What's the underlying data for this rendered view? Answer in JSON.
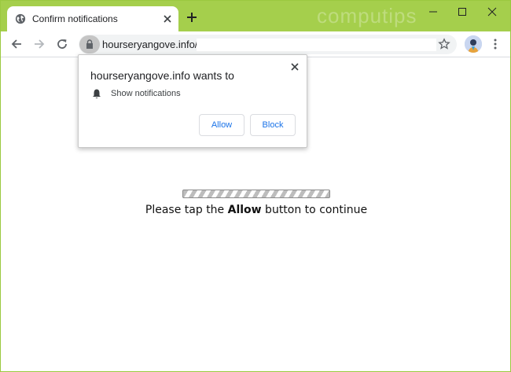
{
  "browser": {
    "tab": {
      "title": "Confirm notifications",
      "icon": "globe-icon"
    },
    "watermark": "computips",
    "window_controls": [
      "minimize-icon",
      "maximize-icon",
      "close-icon"
    ],
    "address": {
      "url": "hourseryangove.info/",
      "lock_icon": "lock-icon"
    },
    "accent_color": "#a5cf4c"
  },
  "popup": {
    "title": "hourseryangove.info wants to",
    "item": "Show notifications",
    "allow_label": "Allow",
    "block_label": "Block"
  },
  "page": {
    "message_before": "Please tap the ",
    "message_bold": "Allow",
    "message_after": " button to continue"
  }
}
